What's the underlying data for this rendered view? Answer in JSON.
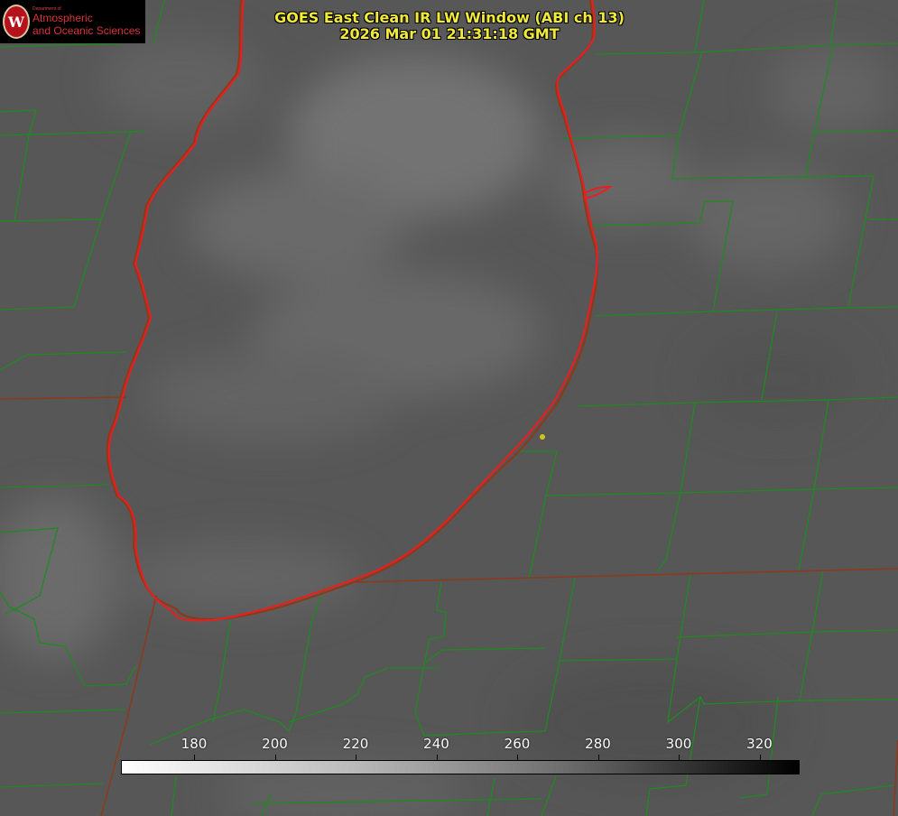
{
  "header": {
    "title_line1": "GOES East Clean IR LW Window (ABI ch 13)",
    "title_line2": "2026 Mar 01 21:31:18 GMT"
  },
  "logo": {
    "seal_letter": "W",
    "dept_text": "Department of",
    "line1": "Atmospheric",
    "line2": "and Oceanic Sciences"
  },
  "colorbar": {
    "ticks": [
      "180",
      "200",
      "220",
      "240",
      "260",
      "280",
      "300",
      "320"
    ],
    "gradient": "white-to-black"
  },
  "colors": {
    "background": "#5a5a5a",
    "lake_outline": "#ee1c1c",
    "county_lines": "#1f8a1f",
    "title": "#f2ea3a",
    "marker": "#d4c21a"
  }
}
